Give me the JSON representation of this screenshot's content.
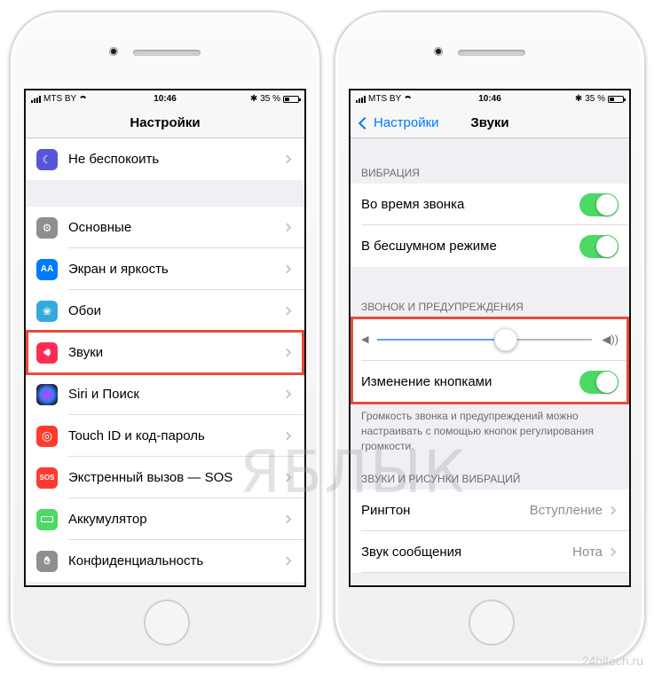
{
  "status": {
    "carrier": "MTS BY",
    "time": "10:46",
    "battery": "35 %"
  },
  "left": {
    "nav_title": "Настройки",
    "rows": [
      {
        "label": "Не беспокоить",
        "icon": "moon-icon",
        "color": "#5856d6"
      },
      {
        "label": "Основные",
        "icon": "gear-icon",
        "color": "#8e8e93"
      },
      {
        "label": "Экран и яркость",
        "icon": "aa-icon",
        "color": "#007aff",
        "glyph": "AA"
      },
      {
        "label": "Обои",
        "icon": "flower-icon",
        "color": "#34aadc"
      },
      {
        "label": "Звуки",
        "icon": "speaker-icon",
        "color": "#ff2d55"
      },
      {
        "label": "Siri и Поиск",
        "icon": "siri-icon",
        "color": "#1c1c2e"
      },
      {
        "label": "Touch ID и код-пароль",
        "icon": "fingerprint-icon",
        "color": "#ff3b30"
      },
      {
        "label": "Экстренный вызов — SOS",
        "icon": "sos-icon",
        "color": "#ff3b30",
        "glyph": "SOS"
      },
      {
        "label": "Аккумулятор",
        "icon": "battery-icon",
        "color": "#4cd964"
      },
      {
        "label": "Конфиденциальность",
        "icon": "hand-icon",
        "color": "#8e8e93"
      }
    ]
  },
  "right": {
    "back_label": "Настройки",
    "nav_title": "Звуки",
    "vibration_header": "ВИБРАЦИЯ",
    "during_call": "Во время звонка",
    "silent_mode": "В бесшумном режиме",
    "ringer_header": "ЗВОНОК И ПРЕДУПРЕЖДЕНИЯ",
    "ringer_volume": 0.6,
    "change_with_buttons": "Изменение кнопками",
    "footer_note": "Громкость звонка и предупреждений можно настраивать с помощью кнопок регулирования громкости.",
    "sounds_header": "ЗВУКИ И РИСУНКИ ВИБРАЦИЙ",
    "ringtone_label": "Рингтон",
    "ringtone_value": "Вступление",
    "message_label": "Звук сообщения",
    "message_value": "Нота"
  },
  "watermark": "ЯБЛЫК",
  "site": "24hitech.ru",
  "accent": "#007aff",
  "toggle_on_color": "#4cd964",
  "highlight_color": "#e74c3c"
}
